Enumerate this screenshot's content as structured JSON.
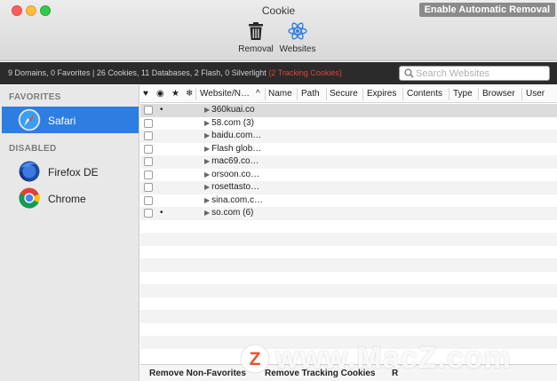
{
  "window": {
    "title": "Cookie",
    "enable_button": "Enable Automatic Removal"
  },
  "toolbar": {
    "removal_label": "Removal",
    "websites_label": "Websites",
    "accent": "#2f7fe0"
  },
  "status": {
    "summary": "9 Domains, 0 Favorites | 26 Cookies, 11 Databases, 2 Flash, 0 Silverlight ",
    "tracking": "(2 Tracking Cookies)",
    "tracking_color": "#e0453a"
  },
  "search": {
    "placeholder": "Search Websites",
    "value": ""
  },
  "sidebar": {
    "favorites_header": "FAVORITES",
    "disabled_header": "DISABLED",
    "items": [
      {
        "label": "Safari",
        "icon": "safari-icon",
        "selected": true
      },
      {
        "label": "Firefox DE",
        "icon": "firefox-icon",
        "selected": false
      },
      {
        "label": "Chrome",
        "icon": "chrome-icon",
        "selected": false
      }
    ]
  },
  "table": {
    "columns": [
      "♥",
      "◉",
      "★",
      "❄",
      "Website/N…",
      "Name",
      "Path",
      "Secure",
      "Expires",
      "Contents",
      "Type",
      "Browser",
      "User"
    ],
    "rows": [
      {
        "marker": "•",
        "site": "360kuai.co"
      },
      {
        "marker": "",
        "site": "58.com (3)"
      },
      {
        "marker": "",
        "site": "baidu.com…"
      },
      {
        "marker": "",
        "site": "Flash glob…"
      },
      {
        "marker": "",
        "site": "mac69.co…"
      },
      {
        "marker": "",
        "site": "orsoon.co…"
      },
      {
        "marker": "",
        "site": "rosettasto…"
      },
      {
        "marker": "",
        "site": "sina.com.c…"
      },
      {
        "marker": "•",
        "site": "so.com (6)"
      }
    ]
  },
  "bottom": {
    "remove_non_favorites": "Remove Non-Favorites",
    "remove_tracking": "Remove Tracking Cookies",
    "remove_other": "R"
  },
  "watermark": {
    "text": "www.MacZ.com",
    "logo_letter": "Z",
    "logo_color": "#e8542c"
  }
}
